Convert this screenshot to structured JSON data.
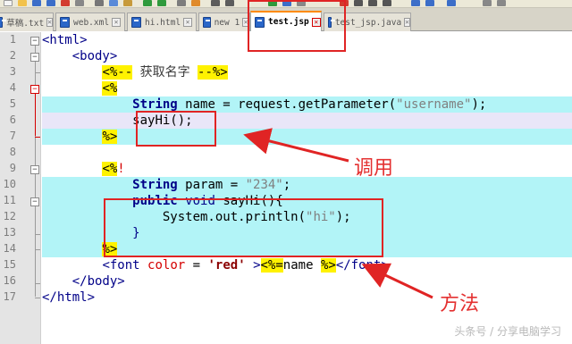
{
  "tabs": [
    {
      "label": "草稿.txt"
    },
    {
      "label": "web.xml"
    },
    {
      "label": "hi.html"
    },
    {
      "label": "new 1"
    },
    {
      "label": "test.jsp",
      "active": true
    },
    {
      "label": "test_jsp.java"
    }
  ],
  "code": {
    "line_numbers": [
      "1",
      "2",
      "3",
      "4",
      "5",
      "6",
      "7",
      "8",
      "9",
      "10",
      "11",
      "12",
      "13",
      "14",
      "15",
      "16",
      "17"
    ],
    "l1": "<html>",
    "l2": "<body>",
    "l3_open": "<%--",
    "l3_text": " 获取名字 ",
    "l3_close": "--%>",
    "l4": "<%",
    "l5_kw": "String",
    "l5_a": " name = request.getParameter(",
    "l5_s": "\"username\"",
    "l5_b": ");",
    "l6": "sayHi();",
    "l7": "%>",
    "l9_open": "<%",
    "l9_bang": "!",
    "l10_kw": "String",
    "l10_a": " param = ",
    "l10_s": "\"234\"",
    "l10_b": ";",
    "l11_kw1": "public",
    "l11_kw2": "void",
    "l11_a": " sayHi(){",
    "l12_a": "System.out.println(",
    "l12_s": "\"hi\"",
    "l12_b": ");",
    "l13": "}",
    "l14": "%>",
    "l15_tag": "<font",
    "l15_attr": "color",
    "l15_eq": " = ",
    "l15_val": "'red'",
    "l15_gt": " >",
    "l15_expr_open": "<%=",
    "l15_expr": "name ",
    "l15_expr_close": "%>",
    "l15_close": "</font>",
    "l16": "</body>",
    "l17": "</html>"
  },
  "annotations": {
    "call_label": "调用",
    "method_label": "方法",
    "color": "#e02424"
  },
  "watermark": "头条号 / 分享电脑学习"
}
